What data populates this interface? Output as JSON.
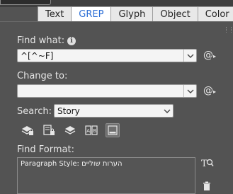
{
  "tabs": [
    {
      "label": "Text",
      "active": false
    },
    {
      "label": "GREP",
      "active": true
    },
    {
      "label": "Glyph",
      "active": false
    },
    {
      "label": "Object",
      "active": false
    },
    {
      "label": "Color",
      "active": false
    }
  ],
  "find_what": {
    "label": "Find what:",
    "value": "^[^~F]"
  },
  "change_to": {
    "label": "Change to:",
    "value": ""
  },
  "search": {
    "label": "Search:",
    "value": "Story"
  },
  "find_format": {
    "label": "Find Format:",
    "value": "Paragraph Style: הערות שוליים"
  },
  "icons": {
    "info": "info-icon",
    "special_chars_find": "at-icon",
    "special_chars_change": "at-icon",
    "include_locked_layers": "locked-layers-icon",
    "include_locked_stories": "locked-stories-icon",
    "include_hidden_layers": "hidden-layers-icon",
    "include_master_pages": "master-pages-icon",
    "include_footnotes": "footnotes-icon",
    "specify_attributes": "specify-attributes-icon",
    "clear_attributes": "trash-icon"
  },
  "colors": {
    "active_tab_text": "#2d6fd6",
    "panel_bg": "#535353"
  }
}
